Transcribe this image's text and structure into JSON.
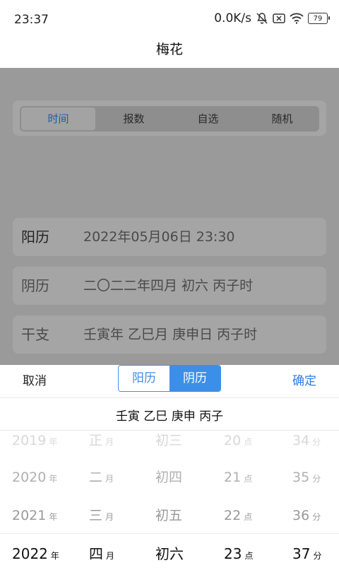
{
  "status": {
    "time": "23:37",
    "net_speed": "0.0K/s",
    "battery": "79"
  },
  "page": {
    "title": "梅花"
  },
  "tabs": [
    {
      "label": "时间",
      "active": true
    },
    {
      "label": "报数",
      "active": false
    },
    {
      "label": "自选",
      "active": false
    },
    {
      "label": "随机",
      "active": false
    }
  ],
  "info": [
    {
      "label": "阳历",
      "value": "2022年05月06日 23:30"
    },
    {
      "label": "阴历",
      "value": "二〇二二年四月 初六 丙子时"
    },
    {
      "label": "干支",
      "value": "壬寅年 乙巳月 庚申日 丙子时"
    }
  ],
  "sheet": {
    "cancel": "取消",
    "confirm": "确定",
    "mode_options": [
      {
        "label": "阳历",
        "active": false
      },
      {
        "label": "阴历",
        "active": true
      }
    ],
    "ganzhi_summary": "壬寅 乙巳 庚申 丙子"
  },
  "picker": {
    "columns": [
      {
        "unit": "年",
        "items": [
          "2019",
          "2020",
          "2021",
          "2022"
        ]
      },
      {
        "unit": "月",
        "items": [
          "正",
          "二",
          "三",
          "四"
        ]
      },
      {
        "unit": "",
        "items": [
          "初三",
          "初四",
          "初五",
          "初六"
        ]
      },
      {
        "unit": "点",
        "items": [
          "20",
          "21",
          "22",
          "23"
        ]
      },
      {
        "unit": "分",
        "items": [
          "34",
          "35",
          "36",
          "37"
        ]
      }
    ],
    "selected_index": 3
  }
}
